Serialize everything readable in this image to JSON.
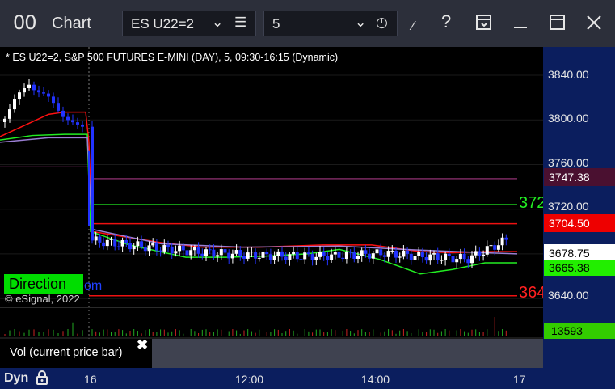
{
  "window": {
    "app_icon": "00",
    "title": "Chart",
    "symbol": "ES U22=2",
    "interval": "5",
    "icons": [
      "chevron-down-icon",
      "list-icon",
      "clock-icon",
      "draw-tool-icon",
      "help-icon",
      "template-icon",
      "maximize-icon",
      "close-icon"
    ]
  },
  "chart": {
    "title": "* ES U22=2, S&P 500 FUTURES E-MINI (DAY), 5, 09:30-16:15 (Dynamic)",
    "price_ticks": [
      "3840.00",
      "3800.00",
      "3760.00",
      "3720.00",
      "3640.00"
    ],
    "price_tags": {
      "magenta_line": {
        "label": "3747.38",
        "bg": "#4a1030",
        "color": "#ffffff"
      },
      "red_line": {
        "label": "3704.50",
        "bg": "#ee0000",
        "color": "#ffffff"
      },
      "last": {
        "label": "3678.75",
        "bg": "#ffffff",
        "color": "#000000"
      },
      "green_avg": {
        "label": "3665.38",
        "bg": "#22ee00",
        "color": "#000000"
      }
    },
    "line_labels": {
      "green": {
        "text": "372",
        "color": "#22ee22"
      },
      "red": {
        "text": "364",
        "color": "#ff2020"
      }
    },
    "direction_label": "Direction",
    "direction_suffix": "om",
    "copyright": "© eSignal, 2022",
    "colors": {
      "up": "#ffffff",
      "down": "#2233ff",
      "ma_red": "#ff1010",
      "ma_green": "#22ee22",
      "ma_purple": "#9b7fd4"
    }
  },
  "volume_pane": {
    "label": "Vol (current price bar)",
    "close_glyph": "✖",
    "value": "13593"
  },
  "time_axis": {
    "mode": "Dyn",
    "ticks": [
      "16",
      "12:00",
      "14:00",
      "17"
    ]
  }
}
